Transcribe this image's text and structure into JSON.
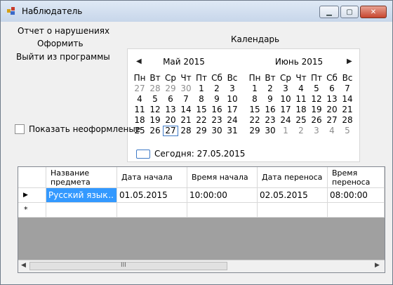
{
  "window": {
    "title": "Наблюдатель"
  },
  "menu": {
    "violations": "Отчет о нарушениях",
    "arrange": "Оформить",
    "exit": "Выйти из программы"
  },
  "calendar": {
    "label": "Календарь",
    "left_month": "Май 2015",
    "right_month": "Июнь 2015",
    "weekdays": [
      "Пн",
      "Вт",
      "Ср",
      "Чт",
      "Пт",
      "Сб",
      "Вс"
    ],
    "may_days": [
      [
        "27",
        "28",
        "29",
        "30",
        "1",
        "2",
        "3"
      ],
      [
        "4",
        "5",
        "6",
        "7",
        "8",
        "9",
        "10"
      ],
      [
        "11",
        "12",
        "13",
        "14",
        "15",
        "16",
        "17"
      ],
      [
        "18",
        "19",
        "20",
        "21",
        "22",
        "23",
        "24"
      ],
      [
        "25",
        "26",
        "27",
        "28",
        "29",
        "30",
        "31"
      ]
    ],
    "june_days": [
      [
        "1",
        "2",
        "3",
        "4",
        "5",
        "6",
        "7"
      ],
      [
        "8",
        "9",
        "10",
        "11",
        "12",
        "13",
        "14"
      ],
      [
        "15",
        "16",
        "17",
        "18",
        "19",
        "20",
        "21"
      ],
      [
        "22",
        "23",
        "24",
        "25",
        "26",
        "27",
        "28"
      ],
      [
        "29",
        "30",
        "1",
        "2",
        "3",
        "4",
        "5"
      ]
    ],
    "today_text": "Сегодня: 27.05.2015",
    "selected_day": "27"
  },
  "options": {
    "show_unformed": "Показать неоформленые"
  },
  "grid": {
    "columns": [
      "Название предмета",
      "Дата начала",
      "Время начала",
      "Дата переноса",
      "Время переноса"
    ],
    "rows": [
      [
        "Русский язык",
        "01.05.2015",
        "10:00:00",
        "02.05.2015",
        "08:00:00"
      ]
    ],
    "scroll_grip": "III"
  }
}
